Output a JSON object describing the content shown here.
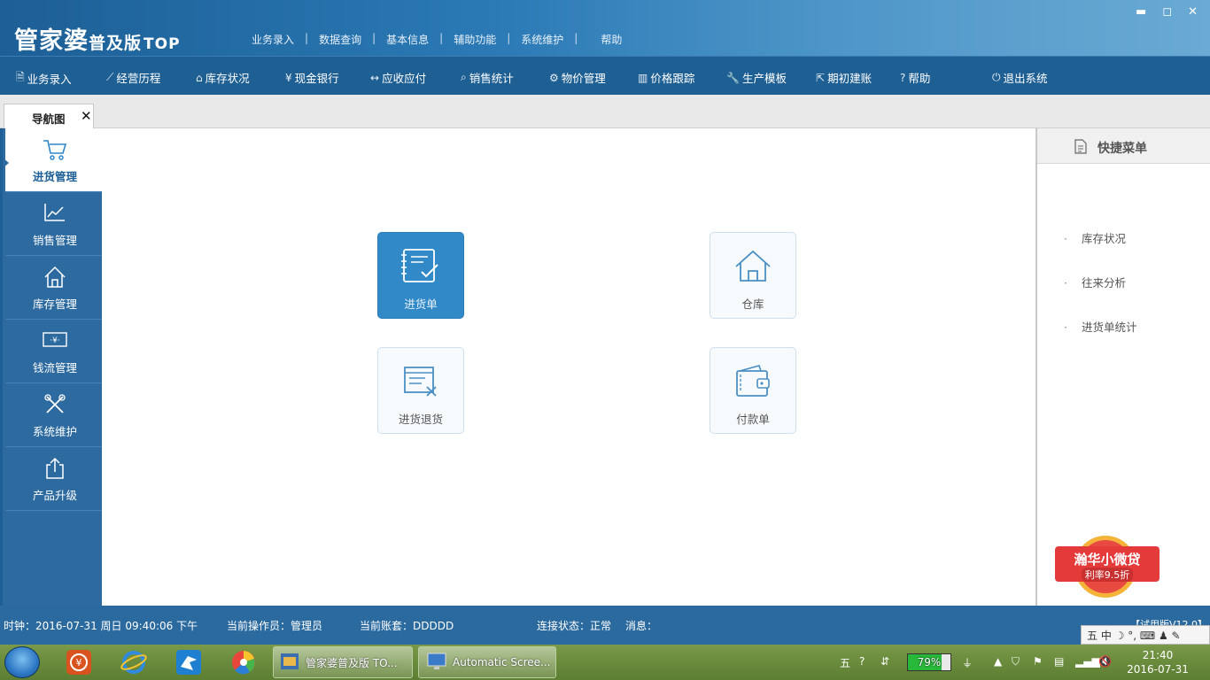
{
  "app": {
    "logo_main": "管家婆",
    "logo_edition": "普及版",
    "logo_top": "TOP"
  },
  "topmenu": [
    "业务录入",
    "数据查询",
    "基本信息",
    "辅助功能",
    "系统维护",
    "帮助"
  ],
  "toolbar": [
    {
      "label": "业务录入",
      "icon": "doc-edit-icon"
    },
    {
      "label": "经营历程",
      "icon": "chart-line-icon"
    },
    {
      "label": "库存状况",
      "icon": "home-icon"
    },
    {
      "label": "现金银行",
      "icon": "yen-icon"
    },
    {
      "label": "应收应付",
      "icon": "arrows-icon"
    },
    {
      "label": "销售统计",
      "icon": "search-icon"
    },
    {
      "label": "物价管理",
      "icon": "gear-icon"
    },
    {
      "label": "价格跟踪",
      "icon": "bar-chart-icon"
    },
    {
      "label": "生产模板",
      "icon": "wrench-icon"
    },
    {
      "label": "期初建账",
      "icon": "external-icon"
    },
    {
      "label": "帮助",
      "icon": "question-icon"
    },
    {
      "label": "退出系统",
      "icon": "power-icon"
    }
  ],
  "tab": {
    "label": "导航图"
  },
  "sidebar": [
    {
      "label": "进货管理",
      "icon": "cart-icon",
      "active": true
    },
    {
      "label": "销售管理",
      "icon": "trend-icon"
    },
    {
      "label": "库存管理",
      "icon": "home-icon"
    },
    {
      "label": "钱流管理",
      "icon": "cash-icon"
    },
    {
      "label": "系统维护",
      "icon": "tools-icon"
    },
    {
      "label": "产品升级",
      "icon": "upload-icon"
    }
  ],
  "tiles": [
    {
      "label": "进货单",
      "icon": "notebook-check-icon",
      "primary": true
    },
    {
      "label": "仓库",
      "icon": "home-icon"
    },
    {
      "label": "进货退货",
      "icon": "doc-cancel-icon"
    },
    {
      "label": "付款单",
      "icon": "wallet-icon"
    }
  ],
  "quick": {
    "title": "快捷菜单",
    "items": [
      "库存状况",
      "往来分析",
      "进货单统计"
    ],
    "promo_title": "瀚华小微贷",
    "promo_sub": "利率9.5折"
  },
  "status": {
    "clock": "时钟：2016-07-31 周日 09:40:06 下午",
    "operator": "当前操作员：管理员",
    "account": "当前账套：DDDDD",
    "connection": "连接状态：正常",
    "message": "消息：",
    "version": "【试用版V12.0】"
  },
  "ime": {
    "chars": "五 中 ☽ °, ⌨ ♟ ✎"
  },
  "taskbar": {
    "btn1": "管家婆普及版 TO...",
    "btn2": "Automatic Scree...",
    "battery_pct": "79%",
    "battery_level": 0.79,
    "time": "21:40",
    "date": "2016-07-31"
  }
}
